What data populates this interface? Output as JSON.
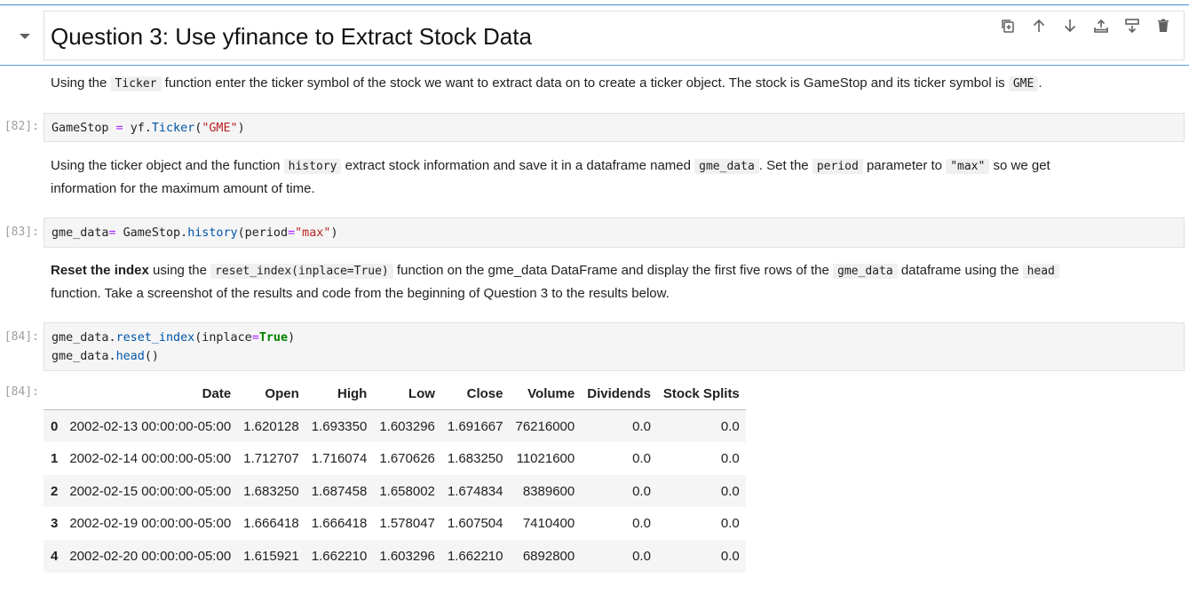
{
  "heading": {
    "title": "Question 3: Use yfinance to Extract Stock Data"
  },
  "toolbar": {
    "icons": [
      "duplicate-icon",
      "move-up-icon",
      "move-down-icon",
      "insert-above-icon",
      "insert-below-icon",
      "delete-icon"
    ]
  },
  "md1": {
    "t1": "Using the ",
    "c1": "Ticker",
    "t2": " function enter the ticker symbol of the stock we want to extract data on to create a ticker object. The stock is GameStop and its ticker symbol is ",
    "c2": "GME",
    "t3": "."
  },
  "cell82": {
    "prompt": "[82]:",
    "var": "GameStop",
    "op": " = ",
    "obj": "yf.",
    "fn": "Ticker",
    "open": "(",
    "str": "\"GME\"",
    "close": ")"
  },
  "md2": {
    "t1": "Using the ticker object and the function ",
    "c1": "history",
    "t2": " extract stock information and save it in a dataframe named ",
    "c2": "gme_data",
    "t3": ". Set the ",
    "c3": "period",
    "t4": " parameter to ",
    "c4": "\"max\"",
    "t5": " so we get",
    "t6": "information for the maximum amount of time."
  },
  "cell83": {
    "prompt": "[83]:",
    "var": "gme_data",
    "op": "=",
    "obj": " GameStop.",
    "fn": "history",
    "open": "(period",
    "eq": "=",
    "str": "\"max\"",
    "close": ")"
  },
  "md3": {
    "bold": "Reset the index",
    "t1": " using the ",
    "c1": "reset_index(inplace=True)",
    "t2": " function on the gme_data DataFrame and display the first five rows of the ",
    "c2": "gme_data",
    "t3": " dataframe using the ",
    "c3": "head",
    "t4": "function. Take a screenshot of the results and code from the beginning of Question 3 to the results below."
  },
  "cell84": {
    "prompt": "[84]:",
    "l1_obj": "gme_data.",
    "l1_fn": "reset_index",
    "l1_open": "(inplace",
    "l1_eq": "=",
    "l1_true": "True",
    "l1_close": ")",
    "l2_obj": "gme_data.",
    "l2_fn": "head",
    "l2_paren": "()"
  },
  "output84": {
    "prompt": "[84]:",
    "columns": [
      "",
      "Date",
      "Open",
      "High",
      "Low",
      "Close",
      "Volume",
      "Dividends",
      "Stock Splits"
    ],
    "rows": [
      [
        "0",
        "2002-02-13 00:00:00-05:00",
        "1.620128",
        "1.693350",
        "1.603296",
        "1.691667",
        "76216000",
        "0.0",
        "0.0"
      ],
      [
        "1",
        "2002-02-14 00:00:00-05:00",
        "1.712707",
        "1.716074",
        "1.670626",
        "1.683250",
        "11021600",
        "0.0",
        "0.0"
      ],
      [
        "2",
        "2002-02-15 00:00:00-05:00",
        "1.683250",
        "1.687458",
        "1.658002",
        "1.674834",
        "8389600",
        "0.0",
        "0.0"
      ],
      [
        "3",
        "2002-02-19 00:00:00-05:00",
        "1.666418",
        "1.666418",
        "1.578047",
        "1.607504",
        "7410400",
        "0.0",
        "0.0"
      ],
      [
        "4",
        "2002-02-20 00:00:00-05:00",
        "1.615921",
        "1.662210",
        "1.603296",
        "1.662210",
        "6892800",
        "0.0",
        "0.0"
      ]
    ]
  },
  "colors": {
    "accent": "#1976d2",
    "string": "#ba2121",
    "function": "#0055aa",
    "operator": "#aa22ff",
    "keyword_true": "#008000"
  }
}
